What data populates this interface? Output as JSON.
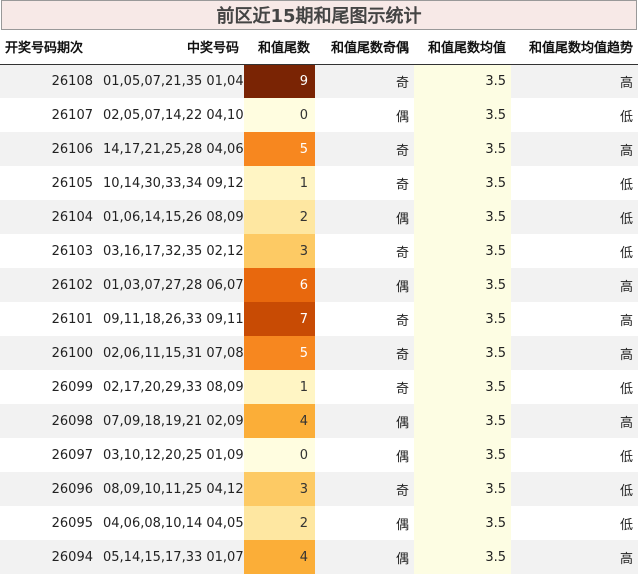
{
  "title": "前区近15期和尾图示统计",
  "chart_data": {
    "type": "table",
    "columns": [
      "开奖号码期次",
      "中奖号码",
      "和值尾数",
      "和值尾数奇偶",
      "和值尾数均值",
      "和值尾数均值趋势"
    ],
    "rows": [
      {
        "issue": "26108",
        "numbers": "01,05,07,21,35 01,04",
        "tail": 9,
        "parity": "奇",
        "mean": "3.5",
        "trend": "高"
      },
      {
        "issue": "26107",
        "numbers": "02,05,07,14,22 04,10",
        "tail": 0,
        "parity": "偶",
        "mean": "3.5",
        "trend": "低"
      },
      {
        "issue": "26106",
        "numbers": "14,17,21,25,28 04,06",
        "tail": 5,
        "parity": "奇",
        "mean": "3.5",
        "trend": "高"
      },
      {
        "issue": "26105",
        "numbers": "10,14,30,33,34 09,12",
        "tail": 1,
        "parity": "奇",
        "mean": "3.5",
        "trend": "低"
      },
      {
        "issue": "26104",
        "numbers": "01,06,14,15,26 08,09",
        "tail": 2,
        "parity": "偶",
        "mean": "3.5",
        "trend": "低"
      },
      {
        "issue": "26103",
        "numbers": "03,16,17,32,35 02,12",
        "tail": 3,
        "parity": "奇",
        "mean": "3.5",
        "trend": "低"
      },
      {
        "issue": "26102",
        "numbers": "01,03,07,27,28 06,07",
        "tail": 6,
        "parity": "偶",
        "mean": "3.5",
        "trend": "高"
      },
      {
        "issue": "26101",
        "numbers": "09,11,18,26,33 09,11",
        "tail": 7,
        "parity": "奇",
        "mean": "3.5",
        "trend": "高"
      },
      {
        "issue": "26100",
        "numbers": "02,06,11,15,31 07,08",
        "tail": 5,
        "parity": "奇",
        "mean": "3.5",
        "trend": "高"
      },
      {
        "issue": "26099",
        "numbers": "02,17,20,29,33 08,09",
        "tail": 1,
        "parity": "奇",
        "mean": "3.5",
        "trend": "低"
      },
      {
        "issue": "26098",
        "numbers": "07,09,18,19,21 02,09",
        "tail": 4,
        "parity": "偶",
        "mean": "3.5",
        "trend": "高"
      },
      {
        "issue": "26097",
        "numbers": "03,10,12,20,25 01,09",
        "tail": 0,
        "parity": "偶",
        "mean": "3.5",
        "trend": "低"
      },
      {
        "issue": "26096",
        "numbers": "08,09,10,11,25 04,12",
        "tail": 3,
        "parity": "奇",
        "mean": "3.5",
        "trend": "低"
      },
      {
        "issue": "26095",
        "numbers": "04,06,08,10,14 04,05",
        "tail": 2,
        "parity": "偶",
        "mean": "3.5",
        "trend": "低"
      },
      {
        "issue": "26094",
        "numbers": "05,14,15,17,33 01,07",
        "tail": 4,
        "parity": "偶",
        "mean": "3.5",
        "trend": "高"
      }
    ],
    "colors": {
      "tail_scale": [
        "#fffde0",
        "#fff5c4",
        "#fee7a1",
        "#fdca64",
        "#fbae38",
        "#f7871f",
        "#e8680d",
        "#c84b04",
        "#a33403",
        "#7a2404"
      ],
      "mean_column_bg": "#fdfde3",
      "title_bg": "#f7e9e7"
    }
  }
}
